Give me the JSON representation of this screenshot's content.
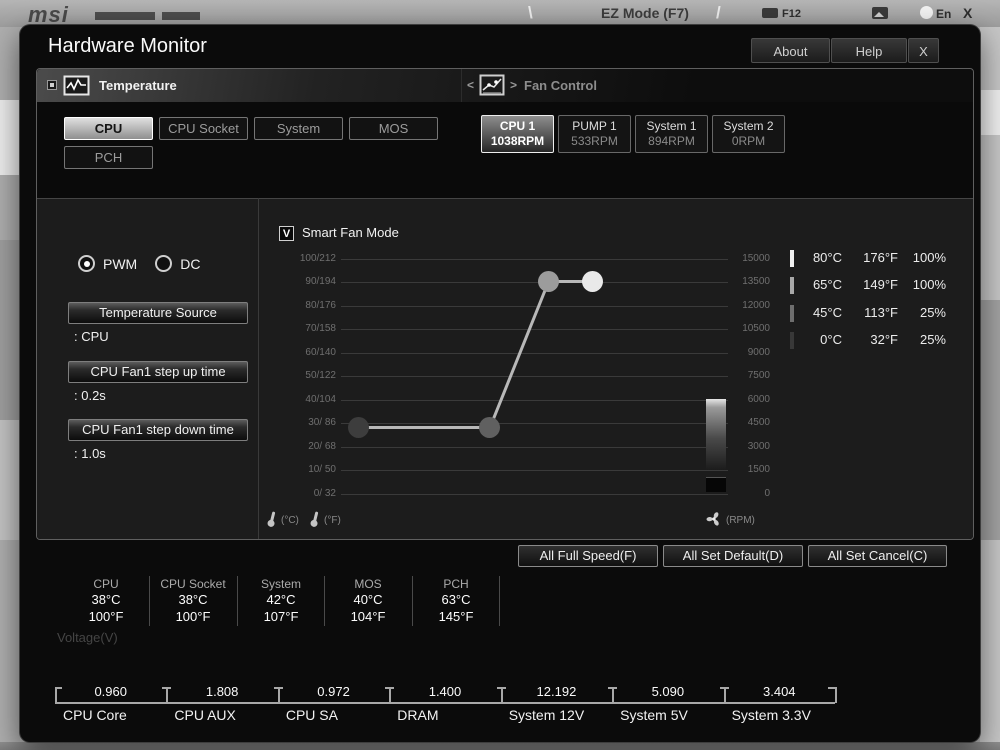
{
  "topbar": {
    "brand": "msi",
    "ez_mode": "EZ Mode (F7)",
    "slash_left": "\\",
    "slash_right": "/",
    "f12": "F12",
    "lang": "En",
    "close": "X"
  },
  "window": {
    "title": "Hardware Monitor",
    "about": "About",
    "help": "Help",
    "close": "X"
  },
  "temp_section": {
    "title": "Temperature",
    "tabs": [
      {
        "label": "CPU",
        "selected": true
      },
      {
        "label": "CPU Socket",
        "selected": false
      },
      {
        "label": "System",
        "selected": false
      },
      {
        "label": "MOS",
        "selected": false
      },
      {
        "label": "PCH",
        "selected": false
      }
    ]
  },
  "fan_section": {
    "title": "Fan Control",
    "prev": "<",
    "next": ">",
    "tabs": [
      {
        "name": "CPU 1",
        "rpm": "1038RPM",
        "selected": true
      },
      {
        "name": "PUMP 1",
        "rpm": "533RPM",
        "selected": false
      },
      {
        "name": "System 1",
        "rpm": "894RPM",
        "selected": false
      },
      {
        "name": "System 2",
        "rpm": "0RPM",
        "selected": false
      }
    ]
  },
  "controls": {
    "radios": [
      {
        "label": "PWM",
        "selected": true
      },
      {
        "label": "DC",
        "selected": false
      }
    ],
    "fields": [
      {
        "button": "Temperature Source",
        "value": ": CPU"
      },
      {
        "button": "CPU Fan1 step up time",
        "value": ": 0.2s"
      },
      {
        "button": "CPU Fan1 step down time",
        "value": ": 1.0s"
      }
    ]
  },
  "smart_fan": {
    "label": "Smart Fan Mode",
    "checked": true,
    "check_glyph": "V",
    "unit_c": "(°C)",
    "unit_f": "(°F)",
    "unit_rpm": "(RPM)"
  },
  "chart_data": {
    "type": "line",
    "title": "Smart Fan Mode curve (CPU Fan 1)",
    "x_axis": {
      "label": "temperature °C",
      "range": [
        0,
        100
      ]
    },
    "left_axis_label": "temperature °C/°F",
    "right_axis_label": "fan speed RPM",
    "left_axis_ticks": [
      "100/212",
      "90/194",
      "80/176",
      "70/158",
      "60/140",
      "50/122",
      "40/104",
      "30/ 86",
      "20/ 68",
      "10/ 50",
      "0/ 32"
    ],
    "right_axis_ticks": [
      "15000",
      "13500",
      "12000",
      "10500",
      "9000",
      "7500",
      "6000",
      "4500",
      "3000",
      "1500",
      "0"
    ],
    "right_axis_range": [
      0,
      15000
    ],
    "grid": true,
    "points": [
      {
        "temp_c": 0,
        "temp_f": 32,
        "duty_pct": 25
      },
      {
        "temp_c": 45,
        "temp_f": 113,
        "duty_pct": 25
      },
      {
        "temp_c": 65,
        "temp_f": 149,
        "duty_pct": 100
      },
      {
        "temp_c": 80,
        "temp_f": 176,
        "duty_pct": 100
      }
    ],
    "point_colors": [
      "#3d3d3d",
      "#606060",
      "#9c9c9c",
      "#e9e9e9"
    ]
  },
  "fan_points": {
    "rows": [
      {
        "c": "80°C",
        "f": "176°F",
        "pct": "100%",
        "bar_color": "#f0f0f0"
      },
      {
        "c": "65°C",
        "f": "149°F",
        "pct": "100%",
        "bar_color": "#a8a8a8"
      },
      {
        "c": "45°C",
        "f": "113°F",
        "pct": "25%",
        "bar_color": "#6e6e6e"
      },
      {
        "c": "0°C",
        "f": "32°F",
        "pct": "25%",
        "bar_color": "#383838"
      }
    ]
  },
  "actions": [
    "All Full Speed(F)",
    "All Set Default(D)",
    "All Set Cancel(C)"
  ],
  "temps": [
    {
      "label": "CPU",
      "c": "38°C",
      "f": "100°F"
    },
    {
      "label": "CPU Socket",
      "c": "38°C",
      "f": "100°F"
    },
    {
      "label": "System",
      "c": "42°C",
      "f": "107°F"
    },
    {
      "label": "MOS",
      "c": "40°C",
      "f": "104°F"
    },
    {
      "label": "PCH",
      "c": "63°C",
      "f": "145°F"
    }
  ],
  "voltage": {
    "section_label": "Voltage(V)",
    "rails": [
      {
        "value": "0.960",
        "label": "CPU Core"
      },
      {
        "value": "1.808",
        "label": "CPU AUX"
      },
      {
        "value": "0.972",
        "label": "CPU SA"
      },
      {
        "value": "1.400",
        "label": "DRAM"
      },
      {
        "value": "12.192",
        "label": "System 12V"
      },
      {
        "value": "5.090",
        "label": "System 5V"
      },
      {
        "value": "3.404",
        "label": "System 3.3V"
      }
    ]
  }
}
